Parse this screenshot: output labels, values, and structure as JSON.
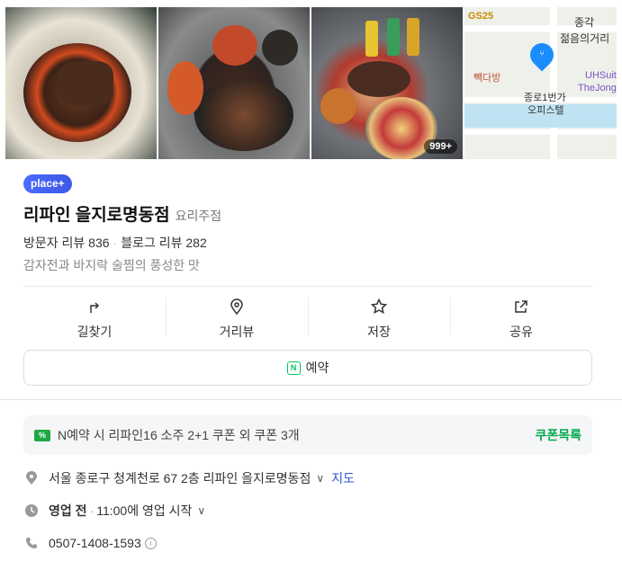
{
  "photos": [
    {
      "name": "photo-steak-bowl"
    },
    {
      "name": "photo-table-spread"
    },
    {
      "name": "photo-pasta-drinks",
      "badge": "999+"
    }
  ],
  "map": {
    "labels": {
      "gs25": "GS25",
      "jonggak": "종각",
      "youth_street": "젊음의거리",
      "paik": "빽다방",
      "uh_suite": "UHSuit",
      "the_jong": "TheJong",
      "office": "종로1번가",
      "office2": "오피스텔"
    }
  },
  "place": {
    "badge": "place+",
    "name": "리파인 을지로명동점",
    "category": "요리주점",
    "visitor_reviews": "방문자 리뷰 836",
    "blog_reviews": "블로그 리뷰 282",
    "description": "감자전과 바지락 술찜의 풍성한 맛"
  },
  "actions": [
    {
      "label": "길찾기",
      "icon": "directions-icon"
    },
    {
      "label": "거리뷰",
      "icon": "street-view-icon"
    },
    {
      "label": "저장",
      "icon": "star-icon"
    },
    {
      "label": "공유",
      "icon": "share-icon"
    }
  ],
  "reserve": {
    "label": "예약",
    "icon_text": "N"
  },
  "coupon": {
    "icon_text": "%",
    "text": "N예약 시 리파인16 소주 2+1 쿠폰 외 쿠폰 3개",
    "link": "쿠폰목록"
  },
  "info": {
    "address": "서울 종로구 청계천로 67 2층 리파인 을지로명동점",
    "map_link": "지도",
    "status": "영업 전",
    "hours": "11:00에 영업 시작",
    "phone": "0507-1408-1593",
    "info_icon_text": "i"
  },
  "colors": {
    "accent_green": "#03c75a",
    "pin_blue": "#1a8cff",
    "link_blue": "#2a59d6"
  }
}
